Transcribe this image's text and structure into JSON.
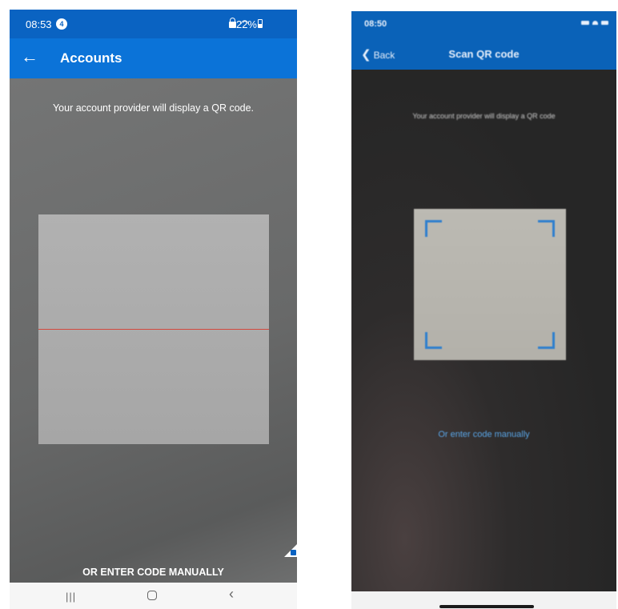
{
  "left_screen": {
    "status_bar": {
      "time": "08:53",
      "notification_count": "4",
      "battery_percent": "22%"
    },
    "app_bar": {
      "title": "Accounts"
    },
    "instruction": "Your account provider will display a QR code.",
    "manual_entry_label": "OR ENTER CODE MANUALLY"
  },
  "right_screen": {
    "status_bar": {
      "time": "08:50"
    },
    "nav_bar": {
      "back_label": "Back",
      "title": "Scan QR code"
    },
    "instruction": "Your account provider will display a QR code",
    "manual_entry_label": "Or enter code manually"
  },
  "colors": {
    "android_header": "#0b73d8",
    "ios_header": "#0a62b8",
    "scan_line": "#d3493e",
    "ios_bracket": "#2f7fce",
    "ios_link": "#5aa5e6"
  },
  "icons": {
    "left_back": "arrow-left-icon",
    "right_back": "chevron-left-icon"
  }
}
